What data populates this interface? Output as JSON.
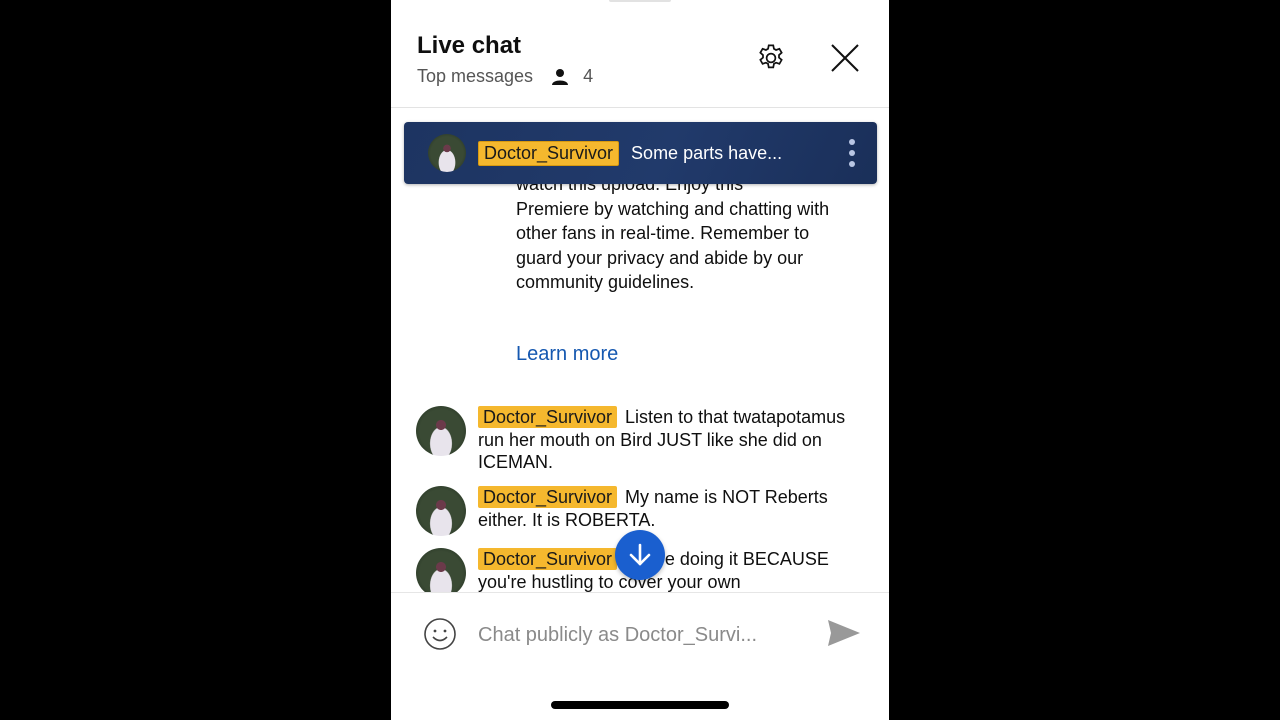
{
  "header": {
    "title": "Live chat",
    "mode_label": "Top messages",
    "viewer_count": "4",
    "settings_icon": "gear-icon",
    "close_icon": "close-icon"
  },
  "pinned": {
    "author": "Doctor_Survivor",
    "text": "Some parts have...",
    "menu_icon": "more-vert-icon"
  },
  "welcome": {
    "text_partial_line": "watch this upload. Enjoy this",
    "text": "Premiere by watching and chatting with other fans in real-time. Remember to guard your privacy and abide by our community guidelines.",
    "learn_more": "Learn more"
  },
  "messages": [
    {
      "author": "Doctor_Survivor",
      "text": "Listen to that twatapotamus run her mouth on Bird JUST like she did on ICEMAN."
    },
    {
      "author": "Doctor_Survivor",
      "text": "My name is NOT Reberts either. It is ROBERTA."
    },
    {
      "author": "Doctor_Survivor",
      "text": "You're doing it BECAUSE you're hustling to cover your own"
    }
  ],
  "composer": {
    "placeholder": "Chat publicly as Doctor_Survi...",
    "emoji_icon": "emoji-icon",
    "send_icon": "send-icon"
  },
  "colors": {
    "badge": "#f5b82e",
    "pinned_bg": "#1d3461",
    "link": "#1558b0",
    "scroll_button": "#1a5fcf"
  }
}
